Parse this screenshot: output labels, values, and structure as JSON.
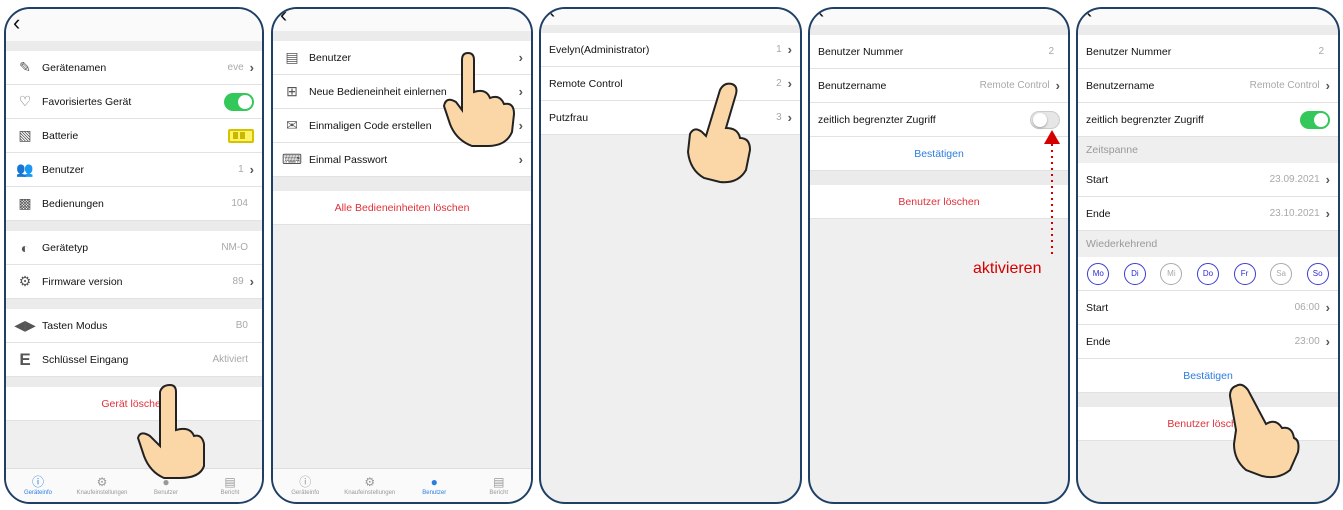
{
  "screen1": {
    "back_icon": "chevron-left-icon",
    "rows": [
      {
        "icon": "pencil-icon",
        "label": "Gerätenamen",
        "value": "eve",
        "chevron": true
      },
      {
        "icon": "heart-icon",
        "label": "Favorisiertes Gerät",
        "toggle": "on"
      },
      {
        "icon": "battery-icon",
        "label": "Batterie",
        "battery": true
      },
      {
        "icon": "users-icon",
        "label": "Benutzer",
        "value": "1",
        "chevron": true
      },
      {
        "icon": "keypad-icon",
        "label": "Bedienungen",
        "value": "104"
      }
    ],
    "rows2": [
      {
        "icon": "cylinder-icon",
        "label": "Gerätetyp",
        "value": "NM-O"
      },
      {
        "icon": "gears-icon",
        "label": "Firmware version",
        "value": "89",
        "chevron": true
      }
    ],
    "rows3": [
      {
        "icon": "arrows-icon",
        "label": "Tasten Modus",
        "value": "B0"
      },
      {
        "icon": "e-icon",
        "label": "Schlüssel Eingang",
        "value": "Aktiviert"
      }
    ],
    "delete_label": "Gerät löschen",
    "tabs": [
      "Geräteinfo",
      "Knaufeinstellungen",
      "Benutzer",
      "Bericht"
    ]
  },
  "screen2": {
    "rows": [
      {
        "icon": "user-card-icon",
        "label": "Benutzer"
      },
      {
        "icon": "plus-square-icon",
        "label": "Neue Bedieneinheit einlernen"
      },
      {
        "icon": "envelope-icon",
        "label": "Einmaligen Code erstellen"
      },
      {
        "icon": "keyboard-icon",
        "label": "Einmal Passwort"
      }
    ],
    "delete_label": "Alle Bedieneinheiten löschen",
    "tabs": [
      "Geräteinfo",
      "Knaufeinstellungen",
      "Benutzer",
      "Bericht"
    ]
  },
  "screen3": {
    "rows": [
      {
        "label": "Evelyn(Administrator)",
        "value": "1"
      },
      {
        "label": "Remote Control",
        "value": "2"
      },
      {
        "label": "Putzfrau",
        "value": "3"
      }
    ]
  },
  "screen4": {
    "number_label": "Benutzer Nummer",
    "number_value": "2",
    "name_label": "Benutzername",
    "name_value": "Remote Control",
    "access_label": "zeitlich begrenzter Zugriff",
    "confirm_label": "Bestätigen",
    "delete_label": "Benutzer löschen",
    "annotation": "aktivieren"
  },
  "screen5": {
    "number_label": "Benutzer Nummer",
    "number_value": "2",
    "name_label": "Benutzername",
    "name_value": "Remote Control",
    "access_label": "zeitlich begrenzter Zugriff",
    "period_section": "Zeitspanne",
    "start_label": "Start",
    "start_value": "23.09.2021",
    "end_label": "Ende",
    "end_value": "23.10.2021",
    "recurring_section": "Wiederkehrend",
    "days": [
      {
        "label": "Mo",
        "active": true
      },
      {
        "label": "Di",
        "active": true
      },
      {
        "label": "Mi",
        "active": false
      },
      {
        "label": "Do",
        "active": true
      },
      {
        "label": "Fr",
        "active": true
      },
      {
        "label": "Sa",
        "active": false
      },
      {
        "label": "So",
        "active": true
      }
    ],
    "time_start_label": "Start",
    "time_start_value": "06:00",
    "time_end_label": "Ende",
    "time_end_value": "23:00",
    "confirm_label": "Bestätigen",
    "delete_label": "Benutzer löschen"
  },
  "colors": {
    "accent": "#2b7de0",
    "danger": "#e0303a",
    "toggle_on": "#34c759",
    "frame": "#1e3f66"
  }
}
